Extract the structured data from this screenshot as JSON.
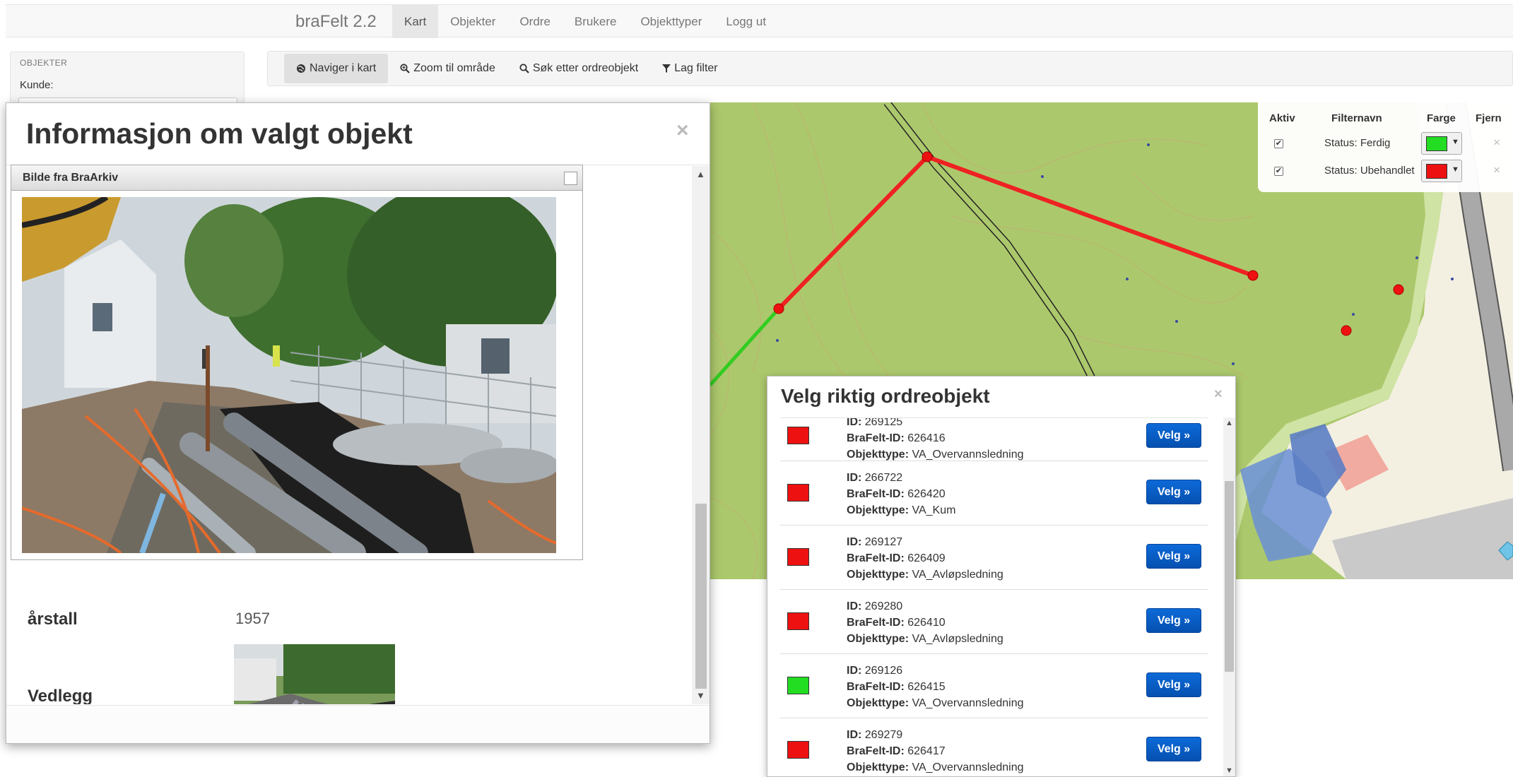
{
  "navbar": {
    "brand": "braFelt 2.2",
    "links": [
      "Kart",
      "Objekter",
      "Ordre",
      "Brukere",
      "Objekttyper",
      "Logg ut"
    ],
    "active": "Kart"
  },
  "objects_panel": {
    "header": "OBJEKTER",
    "kunde_label": "Kunde:"
  },
  "toolbar": {
    "buttons": [
      "Naviger i kart",
      "Zoom til område",
      "Søk etter ordreobjekt",
      "Lag filter"
    ],
    "active": "Naviger i kart"
  },
  "filter_panel": {
    "headers": {
      "aktiv": "Aktiv",
      "filternavn": "Filternavn",
      "farge": "Farge",
      "fjern": "Fjern"
    },
    "rows": [
      {
        "name": "Status: Ferdig",
        "color": "#22dd22",
        "checked": "✔",
        "remove": "×"
      },
      {
        "name": "Status: Ubehandlet",
        "color": "#ee1111",
        "checked": "✔",
        "remove": "×"
      }
    ]
  },
  "info_modal": {
    "title": "Informasjon om valgt objekt",
    "close": "×",
    "image_dialog_title": "Bilde fra BraArkiv",
    "rows": [
      {
        "label": "årstall",
        "value": "1957"
      },
      {
        "label": "Vedlegg",
        "value": ""
      }
    ]
  },
  "order_modal": {
    "title": "Velg riktig ordreobjekt",
    "close": "×",
    "button_label": "Velg »",
    "field_labels": {
      "id": "ID:",
      "brafelt_id": "BraFelt-ID:",
      "objekttype": "Objekttype:"
    },
    "items": [
      {
        "id": "269125",
        "brafelt_id": "626416",
        "objekttype": "VA_Overvannsledning",
        "color": "#ee1111"
      },
      {
        "id": "266722",
        "brafelt_id": "626420",
        "objekttype": "VA_Kum",
        "color": "#ee1111"
      },
      {
        "id": "269127",
        "brafelt_id": "626409",
        "objekttype": "VA_Avløpsledning",
        "color": "#ee1111"
      },
      {
        "id": "269280",
        "brafelt_id": "626410",
        "objekttype": "VA_Avløpsledning",
        "color": "#ee1111"
      },
      {
        "id": "269126",
        "brafelt_id": "626415",
        "objekttype": "VA_Overvannsledning",
        "color": "#22dd22"
      },
      {
        "id": "269279",
        "brafelt_id": "626417",
        "objekttype": "VA_Overvannsledning",
        "color": "#ee1111"
      }
    ]
  },
  "colors": {
    "map_green": "#acc86c",
    "primary_button": "#0b5fcc",
    "line_red": "#ee2222",
    "line_green": "#33cc22"
  }
}
